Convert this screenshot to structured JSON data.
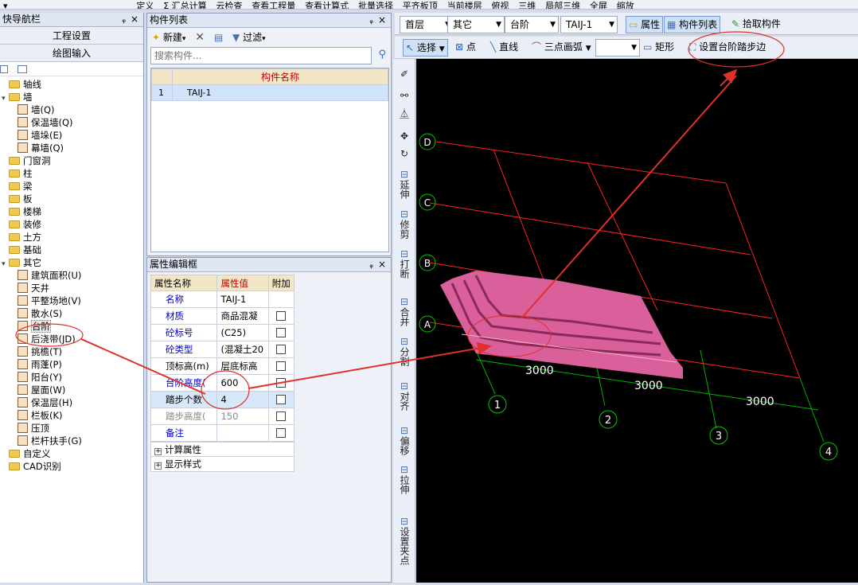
{
  "top_toolbar": {
    "items": [
      "▾",
      "定义",
      "Σ 汇总计算",
      "云检查",
      "查看工程量",
      "查看计算式",
      "批量选择",
      "平齐板顶",
      "当前楼层",
      "俯视",
      "三维",
      "局部三维",
      "全屏",
      "缩放"
    ]
  },
  "nav": {
    "title": "快导航栏",
    "pin": "ᵩ",
    "close": "×",
    "buttons": [
      "工程设置",
      "绘图输入"
    ],
    "tree": [
      {
        "label": "轴线",
        "type": "folder",
        "level": 0
      },
      {
        "label": "墙",
        "type": "folder",
        "level": 0,
        "expanded": true
      },
      {
        "label": "墙(Q)",
        "type": "leaf",
        "level": 1
      },
      {
        "label": "保温墙(Q)",
        "type": "leaf",
        "level": 1
      },
      {
        "label": "墙垛(E)",
        "type": "leaf",
        "level": 1
      },
      {
        "label": "幕墙(Q)",
        "type": "leaf",
        "level": 1
      },
      {
        "label": "门窗洞",
        "type": "folder",
        "level": 0
      },
      {
        "label": "柱",
        "type": "folder",
        "level": 0
      },
      {
        "label": "梁",
        "type": "folder",
        "level": 0
      },
      {
        "label": "板",
        "type": "folder",
        "level": 0
      },
      {
        "label": "楼梯",
        "type": "folder",
        "level": 0
      },
      {
        "label": "装修",
        "type": "folder",
        "level": 0
      },
      {
        "label": "土方",
        "type": "folder",
        "level": 0
      },
      {
        "label": "基础",
        "type": "folder",
        "level": 0
      },
      {
        "label": "其它",
        "type": "folder",
        "level": 0,
        "expanded": true
      },
      {
        "label": "建筑面积(U)",
        "type": "leaf",
        "level": 1
      },
      {
        "label": "天井",
        "type": "leaf",
        "level": 1
      },
      {
        "label": "平整场地(V)",
        "type": "leaf",
        "level": 1
      },
      {
        "label": "散水(S)",
        "type": "leaf",
        "level": 1
      },
      {
        "label": "台阶",
        "type": "leaf",
        "level": 1,
        "selected": true
      },
      {
        "label": "后浇带(JD)",
        "type": "leaf",
        "level": 1
      },
      {
        "label": "挑檐(T)",
        "type": "leaf",
        "level": 1
      },
      {
        "label": "雨蓬(P)",
        "type": "leaf",
        "level": 1
      },
      {
        "label": "阳台(Y)",
        "type": "leaf",
        "level": 1
      },
      {
        "label": "屋面(W)",
        "type": "leaf",
        "level": 1
      },
      {
        "label": "保温层(H)",
        "type": "leaf",
        "level": 1
      },
      {
        "label": "栏板(K)",
        "type": "leaf",
        "level": 1
      },
      {
        "label": "压顶",
        "type": "leaf",
        "level": 1
      },
      {
        "label": "栏杆扶手(G)",
        "type": "leaf",
        "level": 1
      },
      {
        "label": "自定义",
        "type": "folder",
        "level": 0
      },
      {
        "label": "CAD识别",
        "type": "folder",
        "level": 0
      }
    ]
  },
  "component_list": {
    "title": "构件列表",
    "pin": "ᵩ",
    "close": "×",
    "new_label": "新建",
    "filter_label": "过滤",
    "search_placeholder": "搜索构件...",
    "col_header": "构件名称",
    "rows": [
      {
        "index": "1",
        "name": "TAIJ-1"
      }
    ]
  },
  "property_editor": {
    "title": "属性编辑框",
    "pin": "ᵩ",
    "close": "×",
    "headers": [
      "属性名称",
      "属性值",
      "附加"
    ],
    "rows": [
      {
        "name": "名称",
        "value": "TAIJ-1",
        "style": "blue",
        "check": false
      },
      {
        "name": "材质",
        "value": "商品混凝",
        "style": "blue",
        "check": true
      },
      {
        "name": "砼标号",
        "value": "(C25)",
        "style": "blue",
        "check": true
      },
      {
        "name": "砼类型",
        "value": "(混凝土20",
        "style": "blue",
        "check": true
      },
      {
        "name": "顶标高(m)",
        "value": "层底标高",
        "style": "black",
        "check": true
      },
      {
        "name": "台阶高度(",
        "value": "600",
        "style": "blue",
        "check": true
      },
      {
        "name": "踏步个数",
        "value": "4",
        "style": "black",
        "check": true
      },
      {
        "name": "踏步高度(",
        "value": "150",
        "style": "gray",
        "check": true
      },
      {
        "name": "备注",
        "value": "",
        "style": "blue",
        "check": true
      }
    ],
    "groups": [
      "计算属性",
      "显示样式"
    ]
  },
  "drawing_toolbar": {
    "floor": "首层",
    "category": "其它",
    "type": "台阶",
    "component": "TAIJ-1",
    "attr_btn": "属性",
    "list_btn": "构件列表",
    "pick_btn": "拾取构件",
    "select_btn": "选择",
    "point_btn": "点",
    "line_btn": "直线",
    "arc_btn": "三点画弧",
    "rect_btn": "矩形",
    "step_edge_btn": "设置台阶踏步边"
  },
  "vertical_tools": [
    "延伸",
    "修剪",
    "打断",
    "合并",
    "分割",
    "对齐",
    "偏移",
    "拉伸",
    "设置夹点"
  ],
  "canvas": {
    "axes_letters": [
      "D",
      "C",
      "B",
      "A"
    ],
    "axes_numbers": [
      "1",
      "2",
      "3",
      "4"
    ],
    "dims": [
      "3000",
      "3000",
      "3000"
    ],
    "colors": {
      "grid": "#ff2020",
      "axis": "#00c800",
      "step": "#d9609a",
      "arrow": "#e0302a"
    }
  }
}
